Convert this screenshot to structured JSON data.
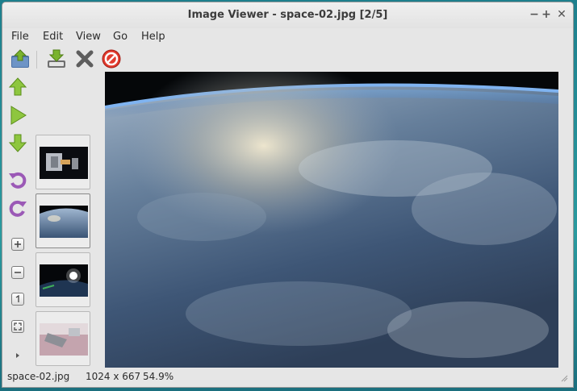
{
  "window": {
    "title": "Image Viewer - space-02.jpg [2/5]"
  },
  "window_controls": {
    "minimize": "−",
    "maximize": "+",
    "close": "✕"
  },
  "menu": [
    "File",
    "Edit",
    "View",
    "Go",
    "Help"
  ],
  "toolbar": {
    "icons": [
      "open-folder-icon",
      "save-download-icon",
      "close-x-icon",
      "stop-icon"
    ]
  },
  "side_tools": {
    "icons": [
      "arrow-up-icon",
      "play-icon",
      "arrow-down-icon",
      "rotate-ccw-icon",
      "rotate-cw-icon",
      "zoom-in-icon",
      "zoom-out-icon",
      "zoom-100-icon",
      "zoom-fit-icon",
      "expand-arrow-icon"
    ],
    "colors": {
      "green": "#7ab32e",
      "purple": "#9b59b6"
    }
  },
  "thumbnails": {
    "count": 4,
    "selected_index": 1
  },
  "status": {
    "filename": "space-02.jpg",
    "dimensions": "1024 x 667",
    "zoom": "54.9%"
  }
}
